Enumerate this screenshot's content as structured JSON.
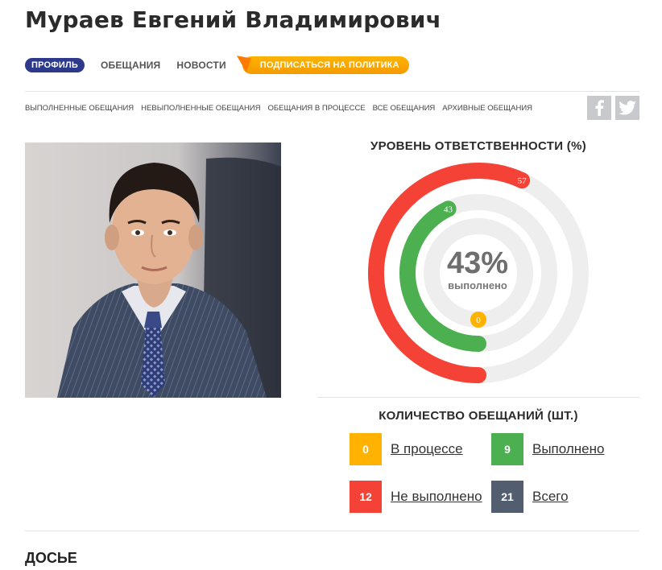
{
  "page": {
    "title": "Мураев Евгений Владимирович"
  },
  "nav": {
    "tabs": [
      {
        "label": "ПРОФИЛЬ",
        "active": true
      },
      {
        "label": "ОБЕЩАНИЯ",
        "active": false
      },
      {
        "label": "НОВОСТИ",
        "active": false
      }
    ],
    "subscribe_label": "ПОДПИСАТЬСЯ НА ПОЛИТИКА"
  },
  "filters": [
    "ВЫПОЛНЕННЫЕ ОБЕЩАНИЯ",
    "НЕВЫПОЛНЕННЫЕ ОБЕЩАНИЯ",
    "ОБЕЩАНИЯ В ПРОЦЕССЕ",
    "ВСЕ ОБЕЩАНИЯ",
    "АРХИВНЫЕ ОБЕЩАНИЯ"
  ],
  "social": {
    "facebook_icon": "facebook-icon",
    "twitter_icon": "twitter-icon"
  },
  "responsibility": {
    "title": "УРОВЕНЬ ОТВЕТСТВЕННОСТИ (%)",
    "center_value": "43%",
    "center_label": "выполнено",
    "rings": [
      {
        "name": "not_fulfilled",
        "value": 57,
        "color": "#f44336"
      },
      {
        "name": "fulfilled",
        "value": 43,
        "color": "#4caf50"
      },
      {
        "name": "in_progress",
        "value": 0,
        "color": "#ffb300"
      }
    ],
    "track_color": "#eeeeee"
  },
  "promises_count": {
    "title": "КОЛИЧЕСТВО ОБЕЩАНИЙ (ШТ.)",
    "items": [
      {
        "value": "0",
        "label": "В процессе",
        "color": "#ffb300"
      },
      {
        "value": "9",
        "label": "Выполнено",
        "color": "#4caf50"
      },
      {
        "value": "12",
        "label": "Не выполнено",
        "color": "#f44336"
      },
      {
        "value": "21",
        "label": "Всего",
        "color": "#525d70"
      }
    ]
  },
  "dossier": {
    "title": "ДОСЬЕ"
  }
}
